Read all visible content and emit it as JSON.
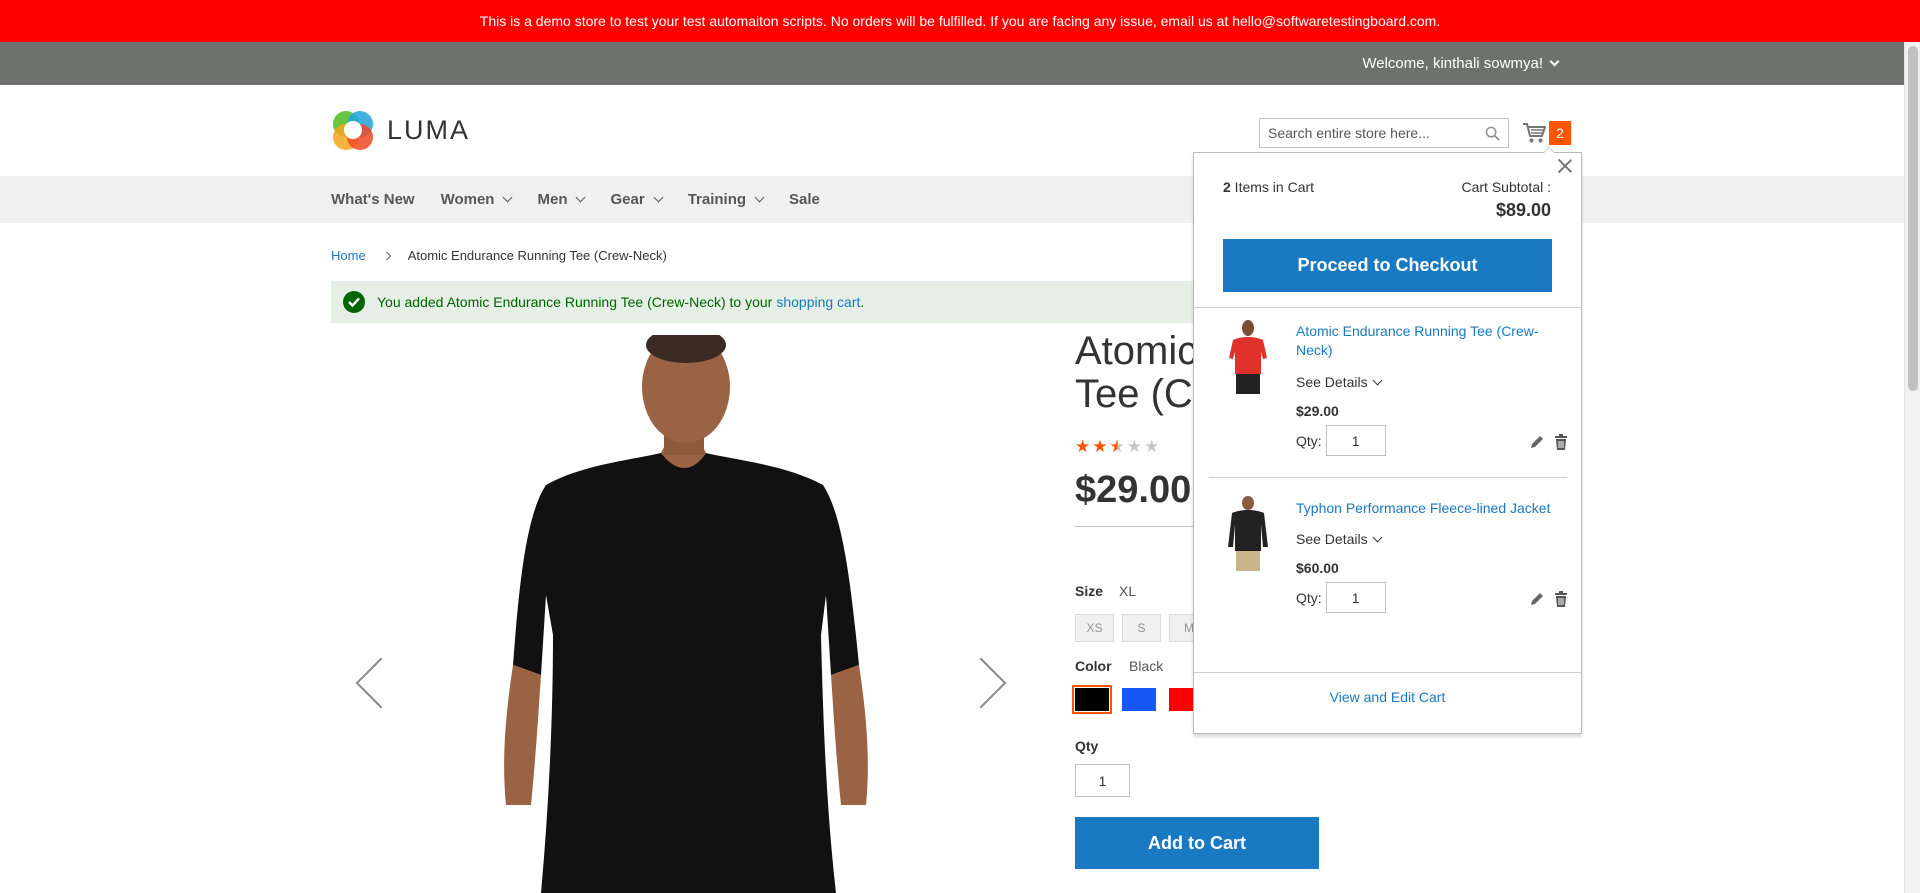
{
  "demo_banner": "This is a demo store to test your test automaiton scripts. No orders will be fulfilled. If you are facing any issue, email us at hello@softwaretestingboard.com.",
  "top_bar": {
    "welcome": "Welcome, kinthali sowmya!"
  },
  "header": {
    "logo_text": "LUMA",
    "search_placeholder": "Search entire store here...",
    "cart_count": "2"
  },
  "nav": {
    "items": [
      {
        "label": "What's New",
        "has_dropdown": false
      },
      {
        "label": "Women",
        "has_dropdown": true
      },
      {
        "label": "Men",
        "has_dropdown": true
      },
      {
        "label": "Gear",
        "has_dropdown": true
      },
      {
        "label": "Training",
        "has_dropdown": true
      },
      {
        "label": "Sale",
        "has_dropdown": false
      }
    ]
  },
  "breadcrumb": {
    "home": "Home",
    "current": "Atomic Endurance Running Tee (Crew-Neck)"
  },
  "success": {
    "message": "You added Atomic Endurance Running Tee (Crew-Neck) to your",
    "link": "shopping cart",
    "suffix": "."
  },
  "product": {
    "title_line1": "Atomic",
    "title_line2": "Tee (Cr",
    "rating_stars_filled": 2.5,
    "price": "$29.00",
    "size_label": "Size",
    "size_selected": "XL",
    "sizes": [
      "XS",
      "S",
      "M"
    ],
    "color_label": "Color",
    "color_selected": "Black",
    "colors": [
      "#000000",
      "#1857f7",
      "#ff0000"
    ],
    "qty_label": "Qty",
    "qty_value": "1",
    "add_to_cart": "Add to Cart"
  },
  "minicart": {
    "count": "2",
    "count_suffix": " Items in Cart",
    "subtotal_label": "Cart Subtotal :",
    "subtotal_value": "$89.00",
    "checkout": "Proceed to Checkout",
    "items": [
      {
        "name": "Atomic Endurance Running Tee (Crew-Neck)",
        "details": "See Details",
        "price": "$29.00",
        "qty_label": "Qty:",
        "qty": "1"
      },
      {
        "name": "Typhon Performance Fleece-lined Jacket",
        "details": "See Details",
        "price": "$60.00",
        "qty_label": "Qty:",
        "qty": "1"
      }
    ],
    "view_edit": "View and Edit Cart"
  },
  "colors": {
    "banner": "#ff0000",
    "primary": "#1979c3",
    "badge": "#ff5501",
    "star": "#ff5501"
  }
}
